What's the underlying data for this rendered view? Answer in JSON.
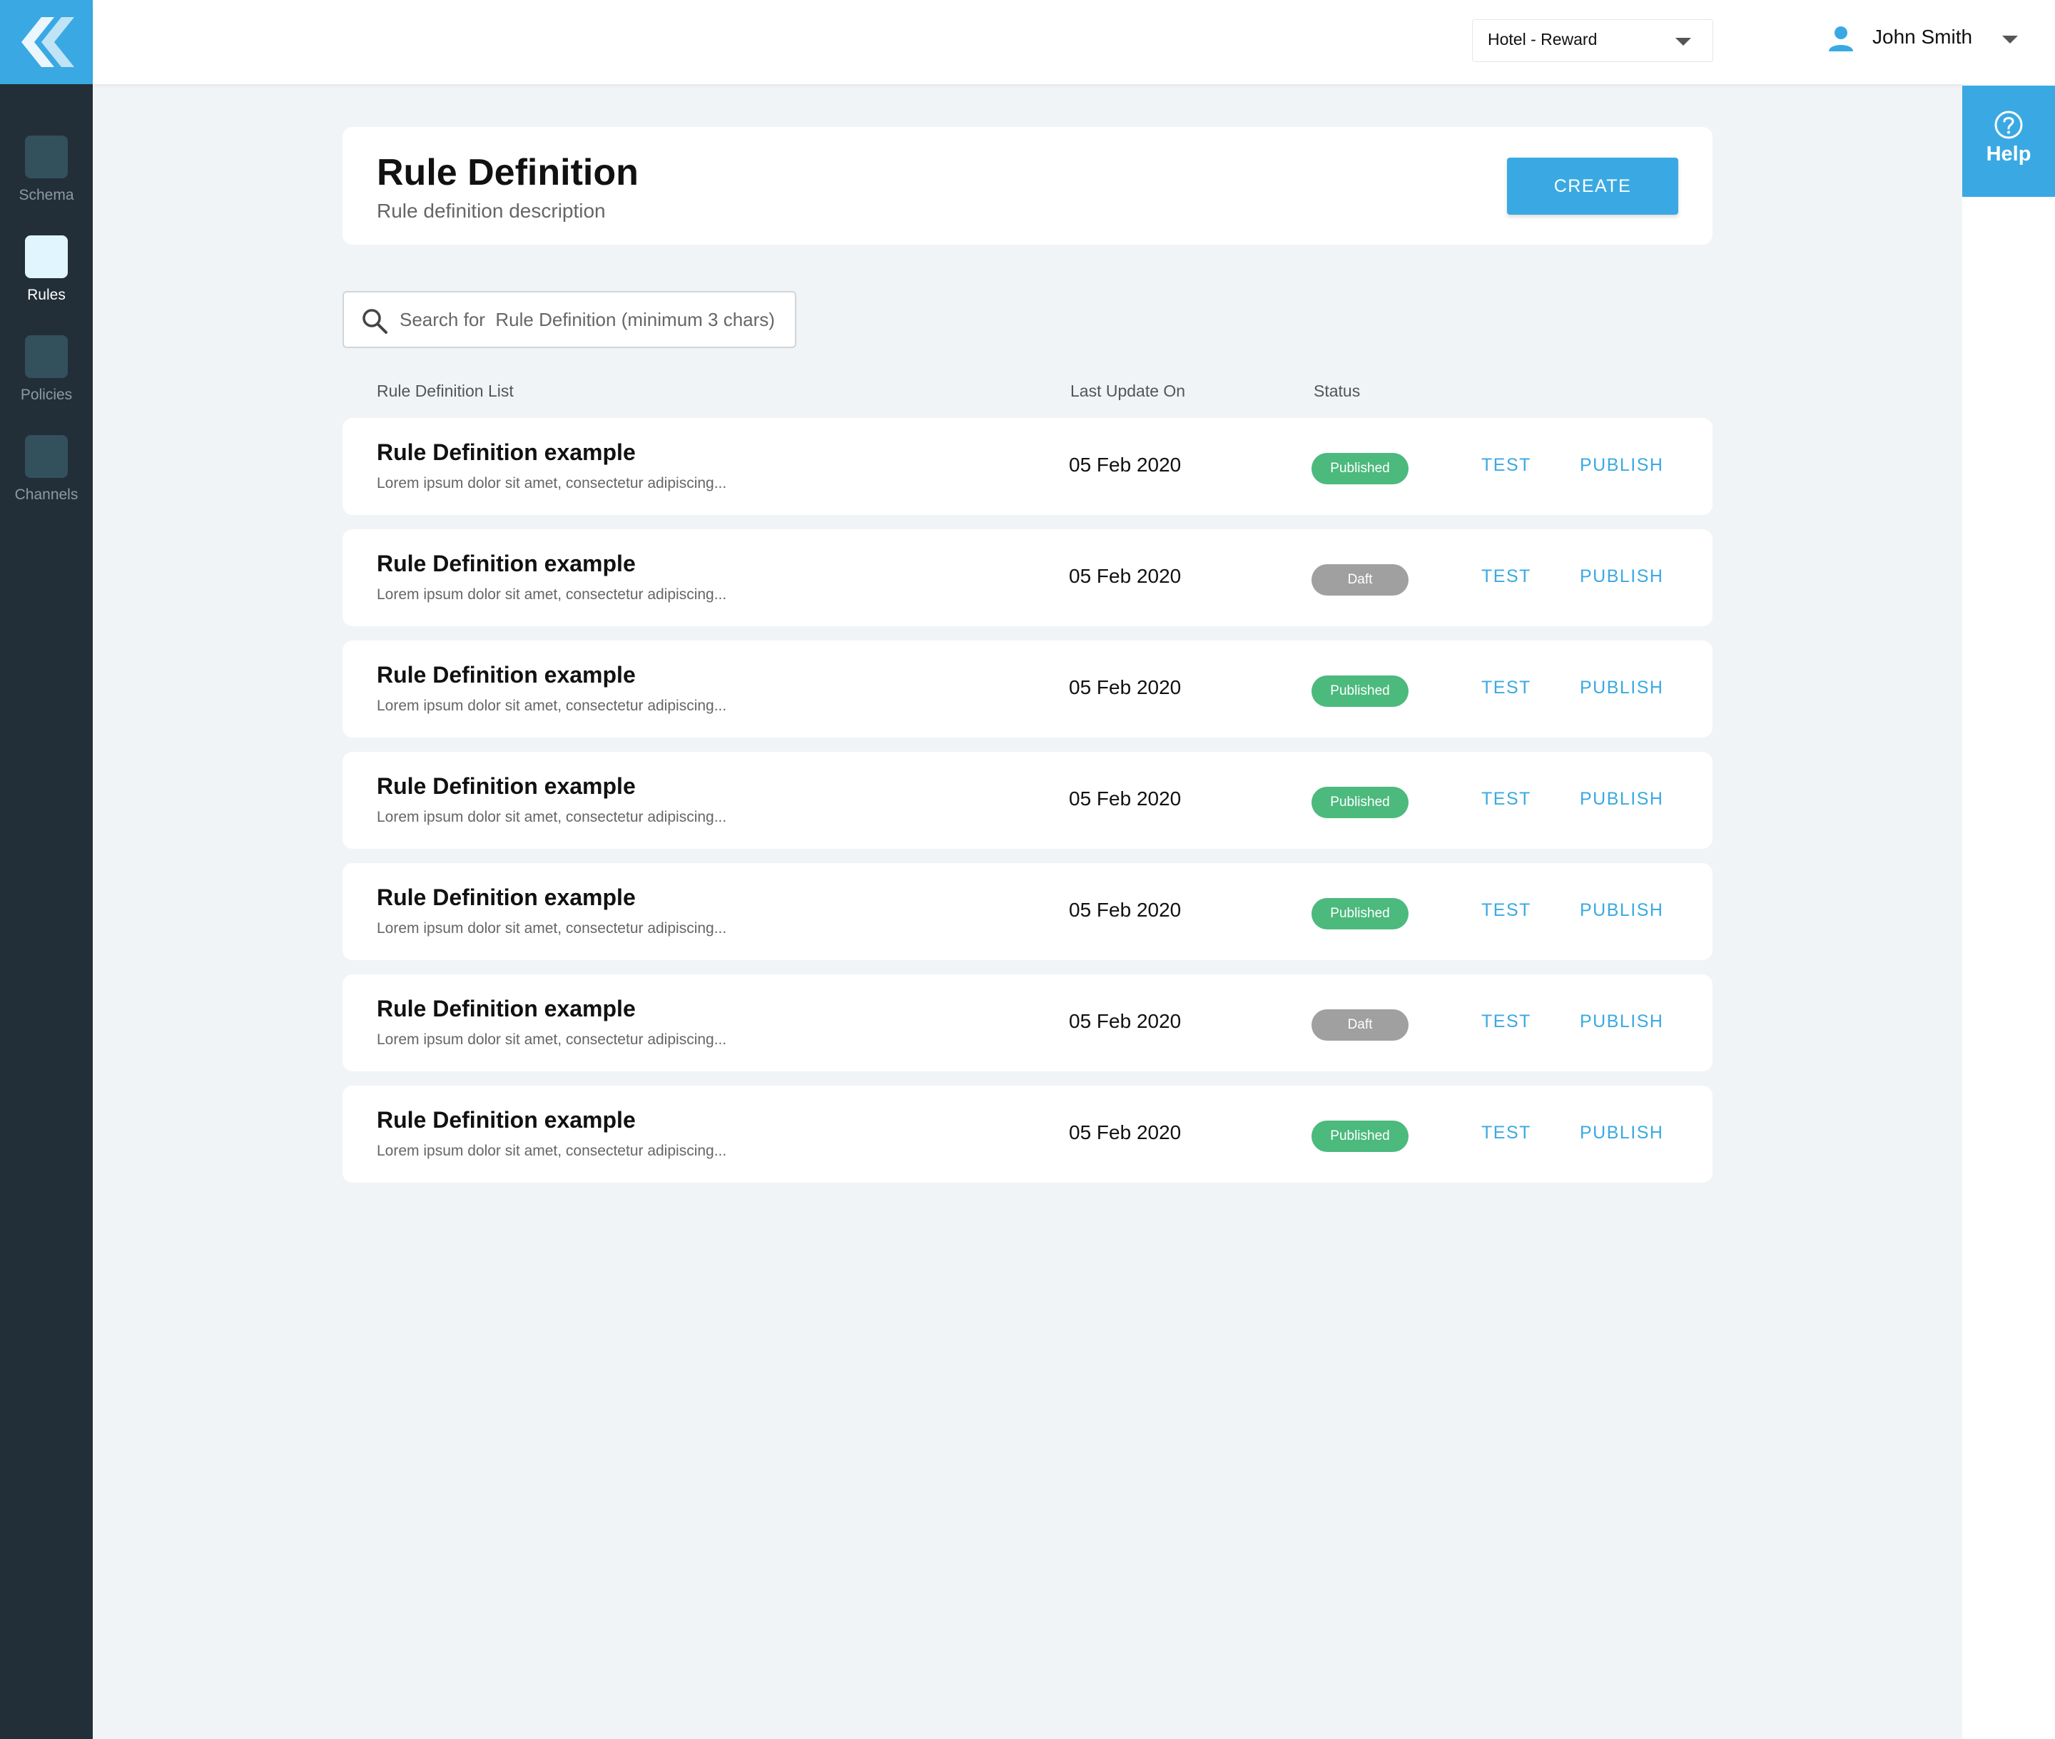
{
  "brand": {
    "accent": "#3aa9e3",
    "sidebar_bg": "#232f38"
  },
  "sidebar": {
    "items": [
      {
        "label": "Schema",
        "active": false
      },
      {
        "label": "Rules",
        "active": true
      },
      {
        "label": "Policies",
        "active": false
      },
      {
        "label": "Channels",
        "active": false
      }
    ]
  },
  "topbar": {
    "property_select": "Hotel - Reward",
    "user_name": "John Smith"
  },
  "help": {
    "label": "Help"
  },
  "header": {
    "title": "Rule Definition",
    "subtitle": "Rule definition description",
    "create_label": "CREATE"
  },
  "search": {
    "placeholder": "Search for  Rule Definition (minimum 3 chars)"
  },
  "table": {
    "columns": [
      "Rule Definition List",
      "Last Update On",
      "Status"
    ],
    "action_test": "TEST",
    "action_publish": "PUBLISH",
    "rows": [
      {
        "title": "Rule Definition example",
        "description": "Lorem ipsum dolor sit amet, consectetur adipiscing...",
        "date": "05 Feb 2020",
        "status": "Published"
      },
      {
        "title": "Rule Definition example",
        "description": "Lorem ipsum dolor sit amet, consectetur adipiscing...",
        "date": "05 Feb 2020",
        "status": "Daft"
      },
      {
        "title": "Rule Definition example",
        "description": "Lorem ipsum dolor sit amet, consectetur adipiscing...",
        "date": "05 Feb 2020",
        "status": "Published"
      },
      {
        "title": "Rule Definition example",
        "description": "Lorem ipsum dolor sit amet, consectetur adipiscing...",
        "date": "05 Feb 2020",
        "status": "Published"
      },
      {
        "title": "Rule Definition example",
        "description": "Lorem ipsum dolor sit amet, consectetur adipiscing...",
        "date": "05 Feb 2020",
        "status": "Published"
      },
      {
        "title": "Rule Definition example",
        "description": "Lorem ipsum dolor sit amet, consectetur adipiscing...",
        "date": "05 Feb 2020",
        "status": "Daft"
      },
      {
        "title": "Rule Definition example",
        "description": "Lorem ipsum dolor sit amet, consectetur adipiscing...",
        "date": "05 Feb 2020",
        "status": "Published"
      }
    ]
  }
}
